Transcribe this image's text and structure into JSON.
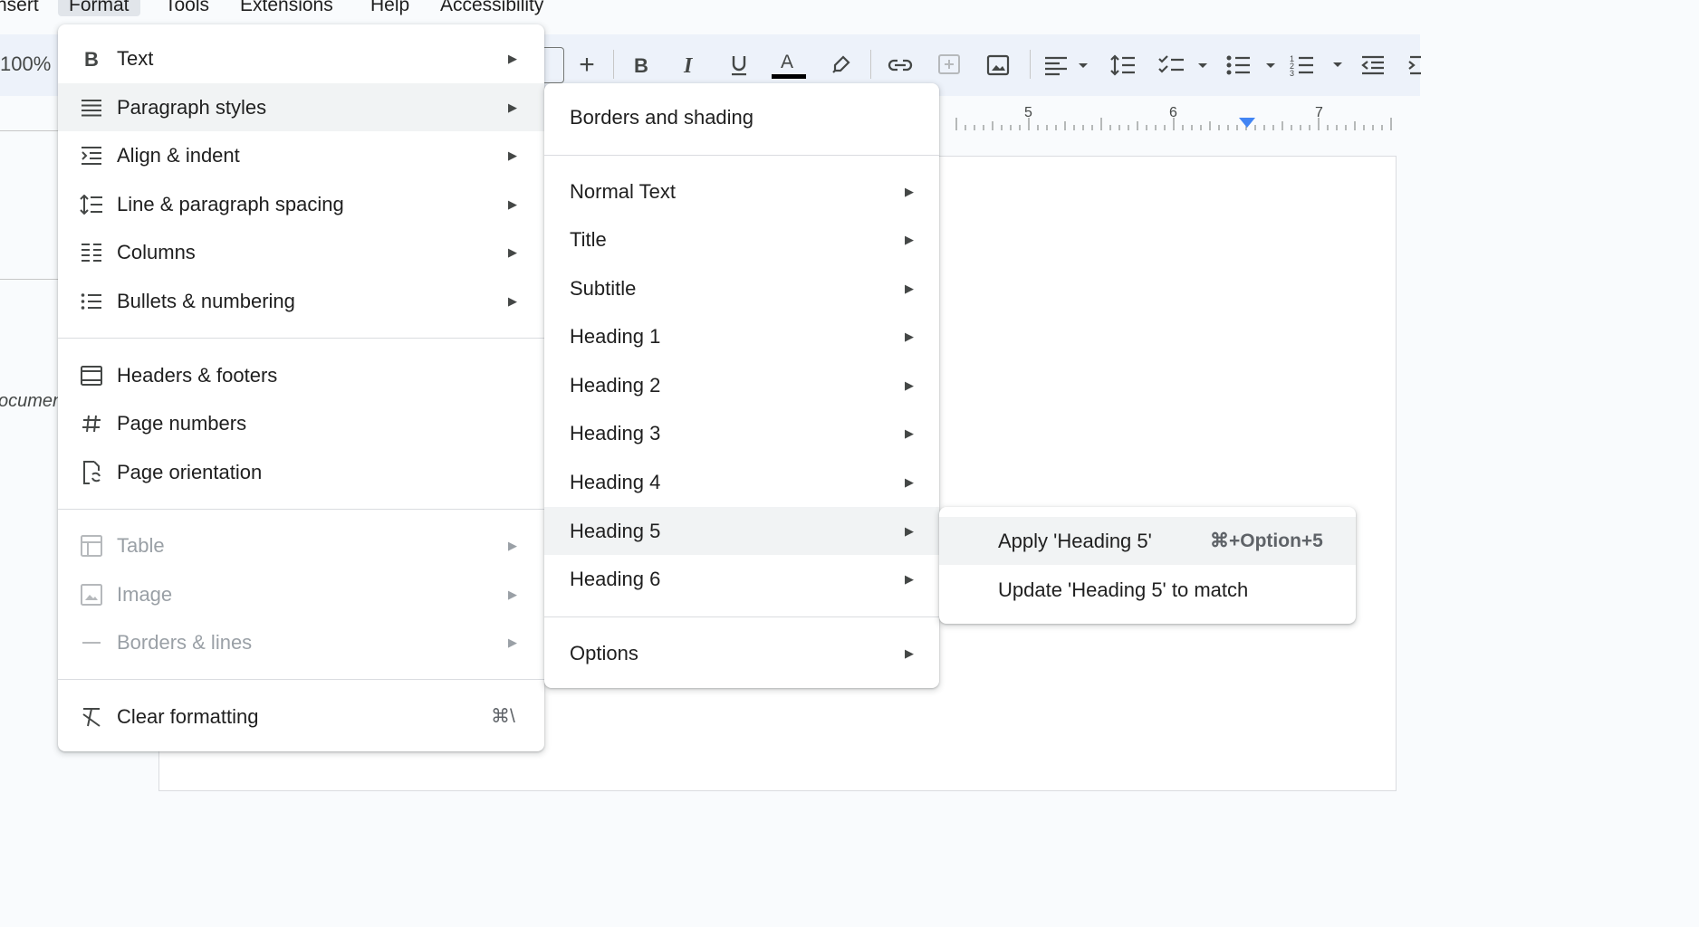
{
  "menubar": {
    "items": [
      "nsert",
      "Format",
      "Tools",
      "Extensions",
      "Help",
      "Accessibility"
    ]
  },
  "toolbar": {
    "zoom": "100%",
    "add_symbol": "+",
    "buttons": [
      "bold-icon",
      "italic-icon",
      "underline-icon",
      "text-color-icon",
      "highlight-icon",
      "link-icon",
      "add-comment-icon",
      "insert-image-icon",
      "align-icon",
      "line-spacing-icon",
      "checklist-icon",
      "bulleted-list-icon",
      "numbered-list-icon",
      "decrease-indent-icon"
    ],
    "text_color_underline": "#000000"
  },
  "ruler": {
    "labels": [
      "5",
      "6",
      "7"
    ],
    "indent_color": "#4285f4"
  },
  "document": {
    "fragment": "ocumen"
  },
  "format_menu": {
    "items": [
      {
        "label": "Text",
        "icon": "bold-icon",
        "submenu": true
      },
      {
        "label": "Paragraph styles",
        "icon": "paragraph-icon",
        "submenu": true,
        "highlighted": true
      },
      {
        "label": "Align & indent",
        "icon": "indent-icon",
        "submenu": true
      },
      {
        "label": "Line & paragraph spacing",
        "icon": "line-spacing-icon",
        "submenu": true
      },
      {
        "label": "Columns",
        "icon": "columns-icon",
        "submenu": true
      },
      {
        "label": "Bullets & numbering",
        "icon": "list-icon",
        "submenu": true
      },
      {
        "label": "Headers & footers",
        "icon": "header-footer-icon"
      },
      {
        "label": "Page numbers",
        "icon": "hash-icon"
      },
      {
        "label": "Page orientation",
        "icon": "page-orientation-icon"
      },
      {
        "label": "Table",
        "icon": "table-icon",
        "submenu": true,
        "disabled": true
      },
      {
        "label": "Image",
        "icon": "image-icon",
        "submenu": true,
        "disabled": true
      },
      {
        "label": "Borders & lines",
        "icon": "borders-icon",
        "submenu": true,
        "disabled": true
      },
      {
        "label": "Clear formatting",
        "icon": "clear-format-icon",
        "shortcut": "⌘\\"
      }
    ],
    "arrow": "▶"
  },
  "paragraph_styles_menu": {
    "borders": "Borders and shading",
    "styles": [
      "Normal Text",
      "Title",
      "Subtitle",
      "Heading 1",
      "Heading 2",
      "Heading 3",
      "Heading 4",
      "Heading 5",
      "Heading 6"
    ],
    "highlighted": "Heading 5",
    "options": "Options",
    "arrow": "▶"
  },
  "heading5_menu": {
    "apply": "Apply 'Heading 5'",
    "apply_shortcut": "⌘+Option+5",
    "update": "Update 'Heading 5' to match"
  }
}
